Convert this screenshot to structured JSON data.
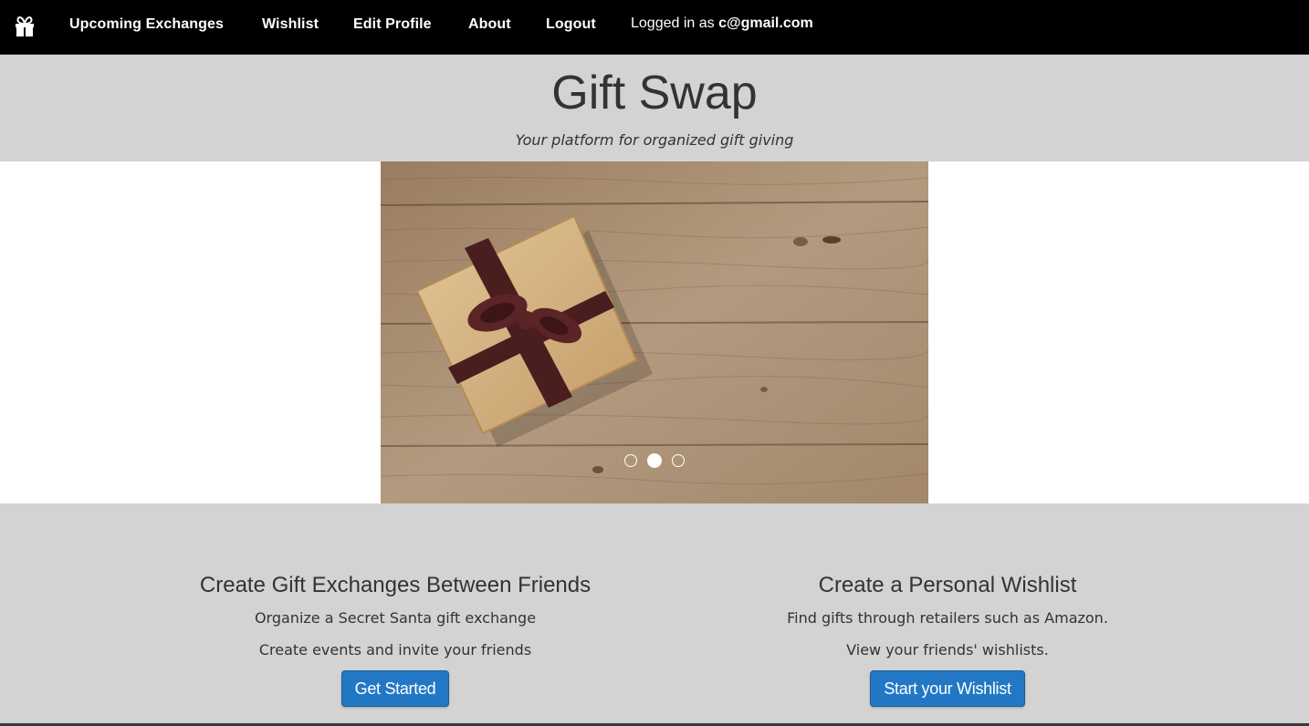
{
  "navbar": {
    "logo_icon": "gift-icon",
    "links": [
      "Upcoming Exchanges",
      "Wishlist",
      "Edit Profile",
      "About",
      "Logout"
    ],
    "logged_in_prefix": "Logged in as ",
    "user_email": "c@gmail.com"
  },
  "header": {
    "title": "Gift Swap",
    "tagline": "Your platform for organized gift giving"
  },
  "carousel": {
    "slide_count": 3,
    "active_index": 1
  },
  "features": [
    {
      "title": "Create Gift Exchanges Between Friends",
      "line1": "Organize a Secret Santa gift exchange",
      "line2": "Create events and invite your friends",
      "button": "Get Started"
    },
    {
      "title": "Create a Personal Wishlist",
      "line1": "Find gifts through retailers such as Amazon.",
      "line2": "View your friends' wishlists.",
      "button": "Start your Wishlist"
    }
  ],
  "colors": {
    "navbar_bg": "#000000",
    "page_bg": "#d3d3d3",
    "button_bg": "#2278c4",
    "ribbon": "#4a1d1f",
    "wood": "#a4876a"
  }
}
